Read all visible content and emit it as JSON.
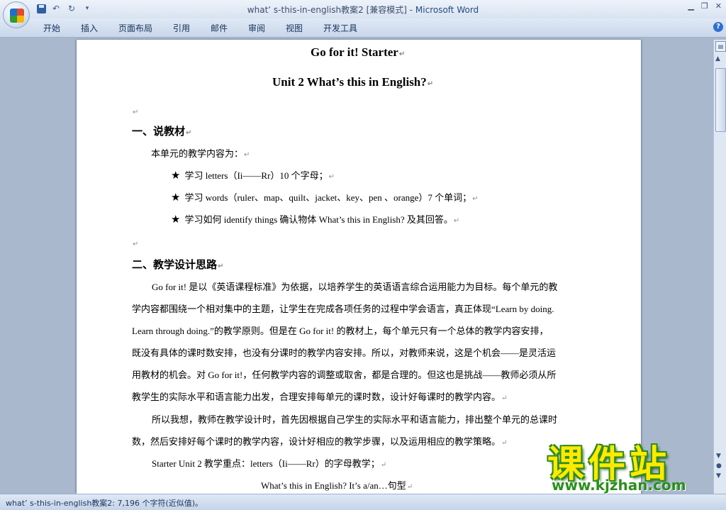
{
  "window": {
    "title_doc": "what’ s-this-in-english教案2 [兼容模式]",
    "title_sep": " - ",
    "title_app": "Microsoft Word"
  },
  "ribbon": {
    "tabs": [
      "开始",
      "插入",
      "页面布局",
      "引用",
      "邮件",
      "审阅",
      "视图",
      "开发工具"
    ]
  },
  "document": {
    "title1": "Go for it! Starter",
    "title2": "Unit 2 What’s this in English?",
    "section1_heading": "一、说教材",
    "section1_intro": "本单元的教学内容为：",
    "bullets": [
      "学习 letters（Ii——Rr）10 个字母；",
      "学习 words（ruler、map、quilt、jacket、key、pen 、orange）7 个单词；",
      "学习如何 identify things  确认物体 What’s this in English?  及其回答。"
    ],
    "section2_heading": "二、教学设计思路",
    "para1_lines": [
      "Go for it!  是以《英语课程标准》为依据，以培养学生的英语语言综合运用能力为目标。每个单元的教",
      "学内容都围绕一个相对集中的主题，让学生在完成各项任务的过程中学会语言，真正体现“Learn by doing.",
      "Learn through doing.”的教学原则。但是在 Go for it!  的教材上，每个单元只有一个总体的教学内容安排，",
      "既没有具体的课时数安排，也没有分课时的教学内容安排。所以，对教师来说，这是个机会——是灵活运",
      "用教材的机会。对 Go for it!，任何教学内容的调整或取舍，都是合理的。但这也是挑战——教师必须从所",
      "教学生的实际水平和语言能力出发，合理安排每单元的课时数，设计好每课时的教学内容。"
    ],
    "para2_lines": [
      "所以我想，教师在教学设计时，首先因根据自己学生的实际水平和语言能力，排出整个单元的总课时",
      "数，然后安排好每个课时的教学内容，设计好相应的教学步骤，以及运用相应的教学策略。"
    ],
    "para3": "Starter Unit 2  教学重点：letters（Ii——Rr）的字母教学；",
    "para4": "What’s this in English? It’s a/an…句型"
  },
  "statusbar": {
    "text": "what’ s-this-in-english教案2: 7,196 个字符(近似值)。"
  },
  "watermark": {
    "cn": "课件站",
    "url": "www.kjzhan.com"
  }
}
